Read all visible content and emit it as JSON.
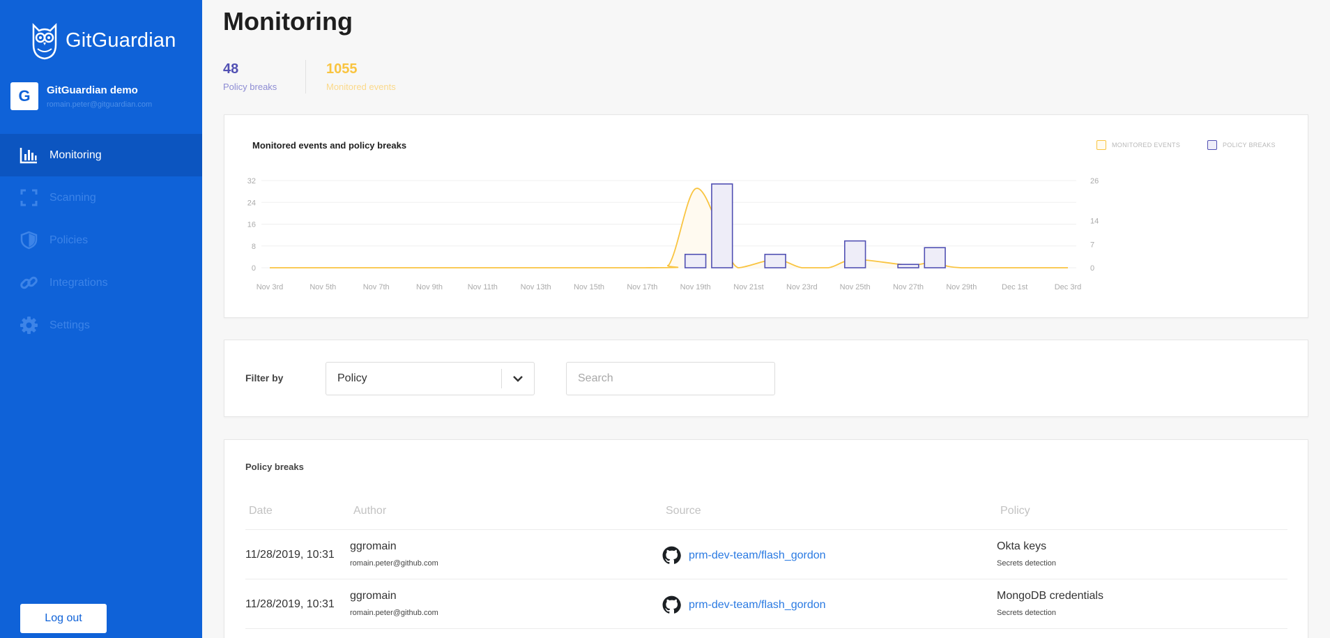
{
  "brand": {
    "name": "GitGuardian"
  },
  "account": {
    "initial": "G",
    "name": "GitGuardian demo",
    "email": "romain.peter@gitguardian.com"
  },
  "nav": {
    "items": [
      {
        "label": "Monitoring",
        "icon": "bar-chart-icon",
        "active": true
      },
      {
        "label": "Scanning",
        "icon": "scan-frame-icon",
        "active": false
      },
      {
        "label": "Policies",
        "icon": "shield-icon",
        "active": false
      },
      {
        "label": "Integrations",
        "icon": "link-icon",
        "active": false
      },
      {
        "label": "Settings",
        "icon": "gear-icon",
        "active": false
      }
    ]
  },
  "logout_label": "Log out",
  "page": {
    "title": "Monitoring"
  },
  "stats": {
    "policy_breaks": {
      "value": "48",
      "label": "Policy breaks",
      "color": "#5150b3"
    },
    "monitored_events": {
      "value": "1055",
      "label": "Monitored events",
      "color": "#f9c440"
    }
  },
  "chart_data": {
    "type": "bar",
    "title": "Monitored events and policy breaks",
    "legend": [
      "MONITORED EVENTS",
      "POLICY BREAKS"
    ],
    "legend_position": "top-right",
    "categories": [
      "Nov 3rd",
      "Nov 5th",
      "Nov 7th",
      "Nov 9th",
      "Nov 11th",
      "Nov 13th",
      "Nov 15th",
      "Nov 17th",
      "Nov 19th",
      "Nov 21st",
      "Nov 23rd",
      "Nov 25th",
      "Nov 27th",
      "Nov 29th",
      "Dec 1st",
      "Dec 3rd"
    ],
    "left_axis": {
      "ticks": [
        0,
        8,
        16,
        24,
        32
      ],
      "range": [
        0,
        32
      ]
    },
    "right_axis": {
      "ticks": [
        0,
        7,
        14,
        26
      ],
      "range": [
        0,
        26
      ]
    },
    "grid": true,
    "series": [
      {
        "name": "MONITORED EVENTS",
        "type": "area",
        "color": "#f9c440",
        "axis": "left",
        "points": [
          {
            "x": "Nov 3rd",
            "y": 0
          },
          {
            "x": "Nov 17th",
            "y": 0
          },
          {
            "x": "Nov 18th",
            "y": 1
          },
          {
            "x": "Nov 19th",
            "y": 29
          },
          {
            "x": "Nov 20th",
            "y": 12
          },
          {
            "x": "Nov 20th-end",
            "y": 0
          },
          {
            "x": "Nov 22nd",
            "y": 3
          },
          {
            "x": "Nov 23rd",
            "y": 0
          },
          {
            "x": "Nov 24th",
            "y": 0
          },
          {
            "x": "Nov 25th",
            "y": 3
          },
          {
            "x": "Nov 27th",
            "y": 1
          },
          {
            "x": "Nov 28th",
            "y": 2
          },
          {
            "x": "Nov 29th",
            "y": 0
          },
          {
            "x": "Dec 3rd",
            "y": 0
          }
        ]
      },
      {
        "name": "POLICY BREAKS",
        "type": "bar",
        "color": "#5150b3",
        "axis": "right",
        "points": [
          {
            "x": "Nov 19th",
            "y": 4
          },
          {
            "x": "Nov 20th",
            "y": 25
          },
          {
            "x": "Nov 22nd",
            "y": 4
          },
          {
            "x": "Nov 25th",
            "y": 8
          },
          {
            "x": "Nov 27th",
            "y": 1
          },
          {
            "x": "Nov 28th",
            "y": 6
          }
        ]
      }
    ]
  },
  "filter": {
    "label": "Filter by",
    "select_value": "Policy",
    "search_placeholder": "Search"
  },
  "table": {
    "title": "Policy breaks",
    "columns": [
      "Date",
      "Author",
      "Source",
      "Policy"
    ],
    "rows": [
      {
        "date": "11/28/2019, 10:31",
        "author": "ggromain",
        "author_email": "romain.peter@github.com",
        "source": "prm-dev-team/flash_gordon",
        "policy": "Okta keys",
        "policy_category": "Secrets detection"
      },
      {
        "date": "11/28/2019, 10:31",
        "author": "ggromain",
        "author_email": "romain.peter@github.com",
        "source": "prm-dev-team/flash_gordon",
        "policy": "MongoDB credentials",
        "policy_category": "Secrets detection"
      }
    ]
  }
}
